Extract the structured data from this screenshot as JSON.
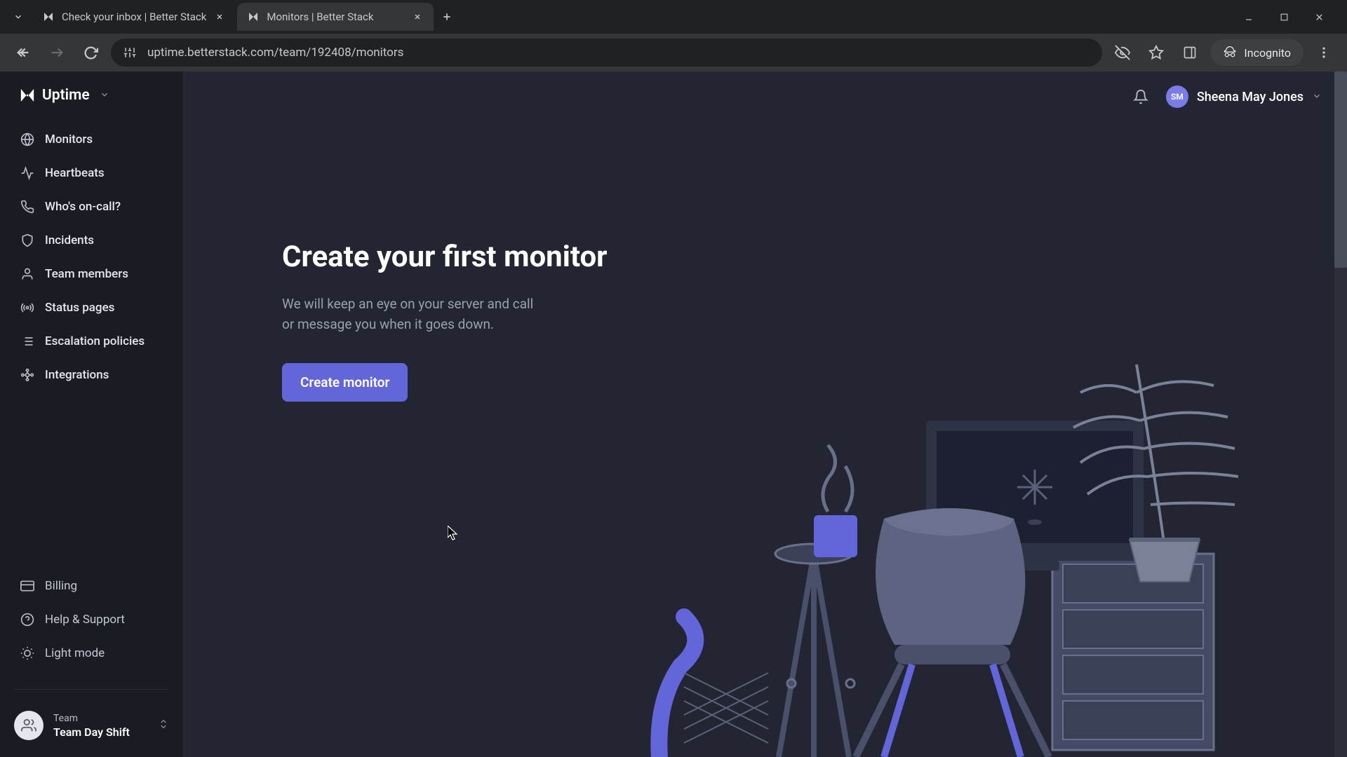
{
  "browser": {
    "tabs": [
      {
        "title": "Check your inbox | Better Stack",
        "active": false
      },
      {
        "title": "Monitors | Better Stack",
        "active": true
      }
    ],
    "url": "uptime.betterstack.com/team/192408/monitors",
    "incognito_label": "Incognito"
  },
  "sidebar": {
    "brand": "Uptime",
    "nav": [
      {
        "id": "monitors",
        "label": "Monitors",
        "icon": "globe"
      },
      {
        "id": "heartbeats",
        "label": "Heartbeats",
        "icon": "activity"
      },
      {
        "id": "oncall",
        "label": "Who's on-call?",
        "icon": "phone"
      },
      {
        "id": "incidents",
        "label": "Incidents",
        "icon": "shield"
      },
      {
        "id": "team",
        "label": "Team members",
        "icon": "user"
      },
      {
        "id": "statuspages",
        "label": "Status pages",
        "icon": "broadcast"
      },
      {
        "id": "escalation",
        "label": "Escalation policies",
        "icon": "list"
      },
      {
        "id": "integrations",
        "label": "Integrations",
        "icon": "plug"
      }
    ],
    "bottom": [
      {
        "id": "billing",
        "label": "Billing",
        "icon": "card"
      },
      {
        "id": "help",
        "label": "Help & Support",
        "icon": "help"
      },
      {
        "id": "lightmode",
        "label": "Light mode",
        "icon": "sun"
      }
    ],
    "team": {
      "label": "Team",
      "name": "Team Day Shift"
    }
  },
  "header": {
    "user_name": "Sheena May Jones",
    "user_initials": "SM"
  },
  "hero": {
    "title": "Create your first monitor",
    "subtitle": "We will keep an eye on your server and call or message you when it goes down.",
    "cta": "Create monitor"
  },
  "colors": {
    "accent": "#6366d8",
    "bg": "#232632",
    "sidebar_bg": "#1a1c24"
  }
}
